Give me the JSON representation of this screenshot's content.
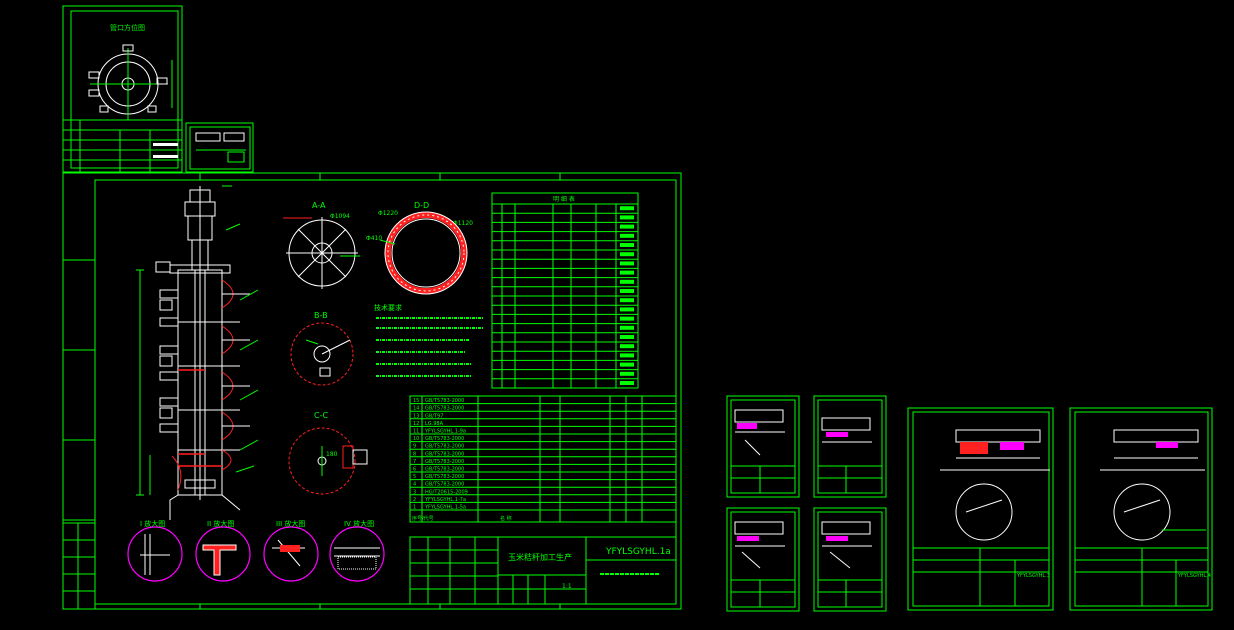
{
  "main_sheet": {
    "section_labels": {
      "aa": "A-A",
      "dd": "D-D",
      "bb": "B-B",
      "cc": "C-C"
    },
    "dimensions": {
      "d1094": "Φ1094",
      "d1220": "Φ1220",
      "d1120": "Φ1120",
      "d410": "Φ410",
      "d180": "180"
    },
    "detail_labels": [
      "I 放大图",
      "II 放大图",
      "III 放大图",
      "IV 放大图"
    ],
    "title_block": {
      "drawing_no": "YFYLSGYHL.1a",
      "title": "玉米秸秆加工生产"
    },
    "notes_heading": "技术要求",
    "parts_list_heading": "明 细 表",
    "parts_rows": [
      {
        "no": "15",
        "code": "GB/T5783-2000"
      },
      {
        "no": "14",
        "code": "GB/T5783-2000"
      },
      {
        "no": "13",
        "code": "GB/T97"
      },
      {
        "no": "12",
        "code": "LG.98A"
      },
      {
        "no": "11",
        "code": "YFYLSGYHL.1-9a"
      },
      {
        "no": "10",
        "code": "GB/T5783-2000"
      },
      {
        "no": "9",
        "code": "GB/T5783-2000"
      },
      {
        "no": "8",
        "code": "GB/T5783-2000"
      },
      {
        "no": "7",
        "code": "GB/T5783-2000"
      },
      {
        "no": "6",
        "code": "GB/T5783-2000"
      },
      {
        "no": "5",
        "code": "GB/T5783-2000"
      },
      {
        "no": "4",
        "code": "GB/T5783-2000"
      },
      {
        "no": "3",
        "code": "HG/T20615-2009"
      },
      {
        "no": "2",
        "code": "YFYLSGYHL.1-7a"
      },
      {
        "no": "1",
        "code": "YFYLSGYHL.1-5a"
      }
    ],
    "parts_header_no": "序号/代号",
    "parts_header_name": "名 称",
    "scale": "1:1"
  },
  "sub_sheets": {
    "small_left_title": "管口方位图",
    "right1_code": "YFYLSGYHL.3",
    "right2_code": "YFYLSGYHL.4"
  },
  "colors": {
    "line": "#00ff00",
    "white": "#ffffff",
    "magenta": "#ff00ff",
    "red": "#ff2020",
    "background": "#000000"
  }
}
